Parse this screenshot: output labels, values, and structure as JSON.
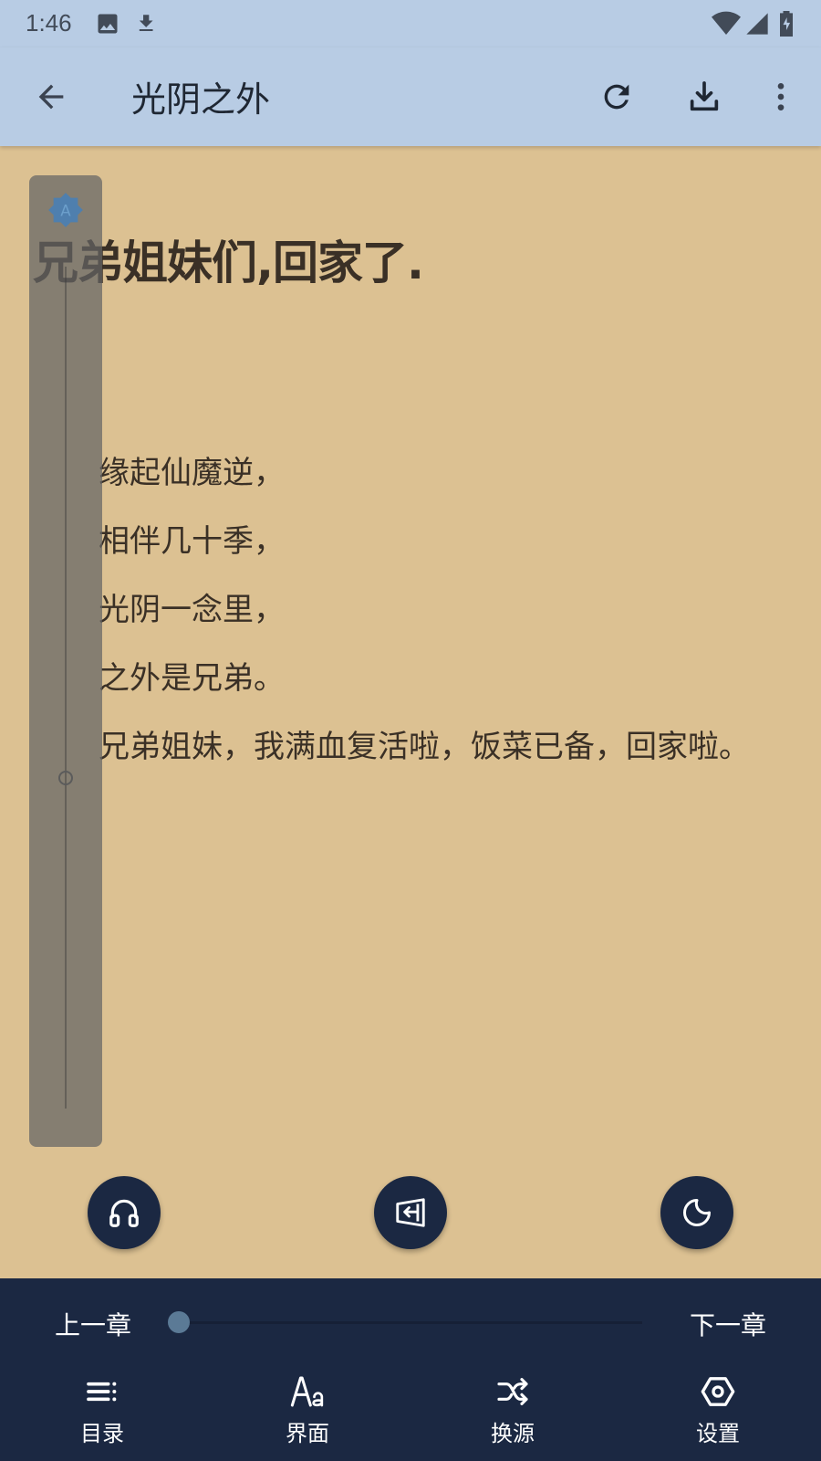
{
  "status_bar": {
    "time": "1:46",
    "icons": [
      "image-icon",
      "download-icon",
      "wifi-icon",
      "signal-icon",
      "battery-icon"
    ]
  },
  "app_bar": {
    "title": "光阴之外",
    "back_icon": "arrow-back-icon",
    "actions": [
      "refresh-icon",
      "download-icon",
      "more-vert-icon"
    ],
    "background_color": "#B8CCE4"
  },
  "reader": {
    "chapter_title": "兄弟姐妹们,回家了.",
    "paragraphs": [
      "缘起仙魔逆，",
      "相伴几十季，",
      "光阴一念里，",
      "之外是兄弟。",
      "兄弟姐妹，我满血复活啦，饭菜已备，回家啦。"
    ],
    "background_color": "#DCC192",
    "brightness_auto_label": "A",
    "brightness_level": 0.4
  },
  "fabs": [
    "headphones-icon",
    "auto-page-icon",
    "night-mode-icon"
  ],
  "bottom_panel": {
    "prev_chapter": "上一章",
    "next_chapter": "下一章",
    "progress": 0.0,
    "tools": [
      {
        "icon": "catalog-icon",
        "label": "目录"
      },
      {
        "icon": "font-icon",
        "label": "界面"
      },
      {
        "icon": "shuffle-icon",
        "label": "换源"
      },
      {
        "icon": "settings-icon",
        "label": "设置"
      }
    ],
    "background_color": "#1B2842"
  }
}
